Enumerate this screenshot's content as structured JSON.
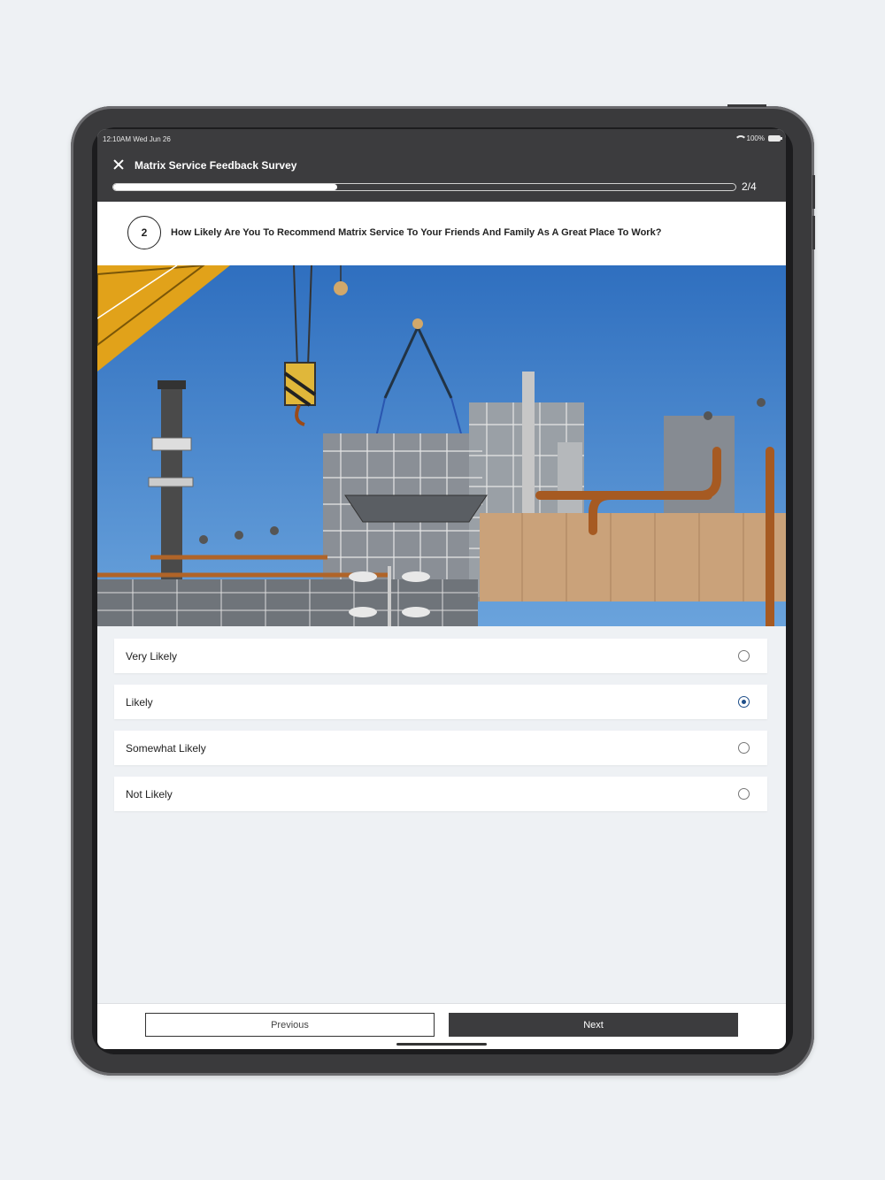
{
  "status_bar": {
    "time": "12:10AM Wed Jun 26",
    "battery": "100%"
  },
  "header": {
    "title": "Matrix Service Feedback Survey",
    "progress_text": "2/4",
    "progress_fraction": 0.5
  },
  "question": {
    "number": "2",
    "text": "How Likely Are You To Recommend Matrix Service To Your Friends And Family As A Great Place To Work?"
  },
  "options": [
    {
      "label": "Very Likely",
      "selected": false
    },
    {
      "label": "Likely",
      "selected": true
    },
    {
      "label": "Somewhat Likely",
      "selected": false
    },
    {
      "label": "Not Likely",
      "selected": false
    }
  ],
  "footer": {
    "previous_label": "Previous",
    "next_label": "Next"
  },
  "colors": {
    "accent": "#1f4f8a",
    "header_bg": "#3c3c3e",
    "page_bg": "#eef1f4"
  }
}
